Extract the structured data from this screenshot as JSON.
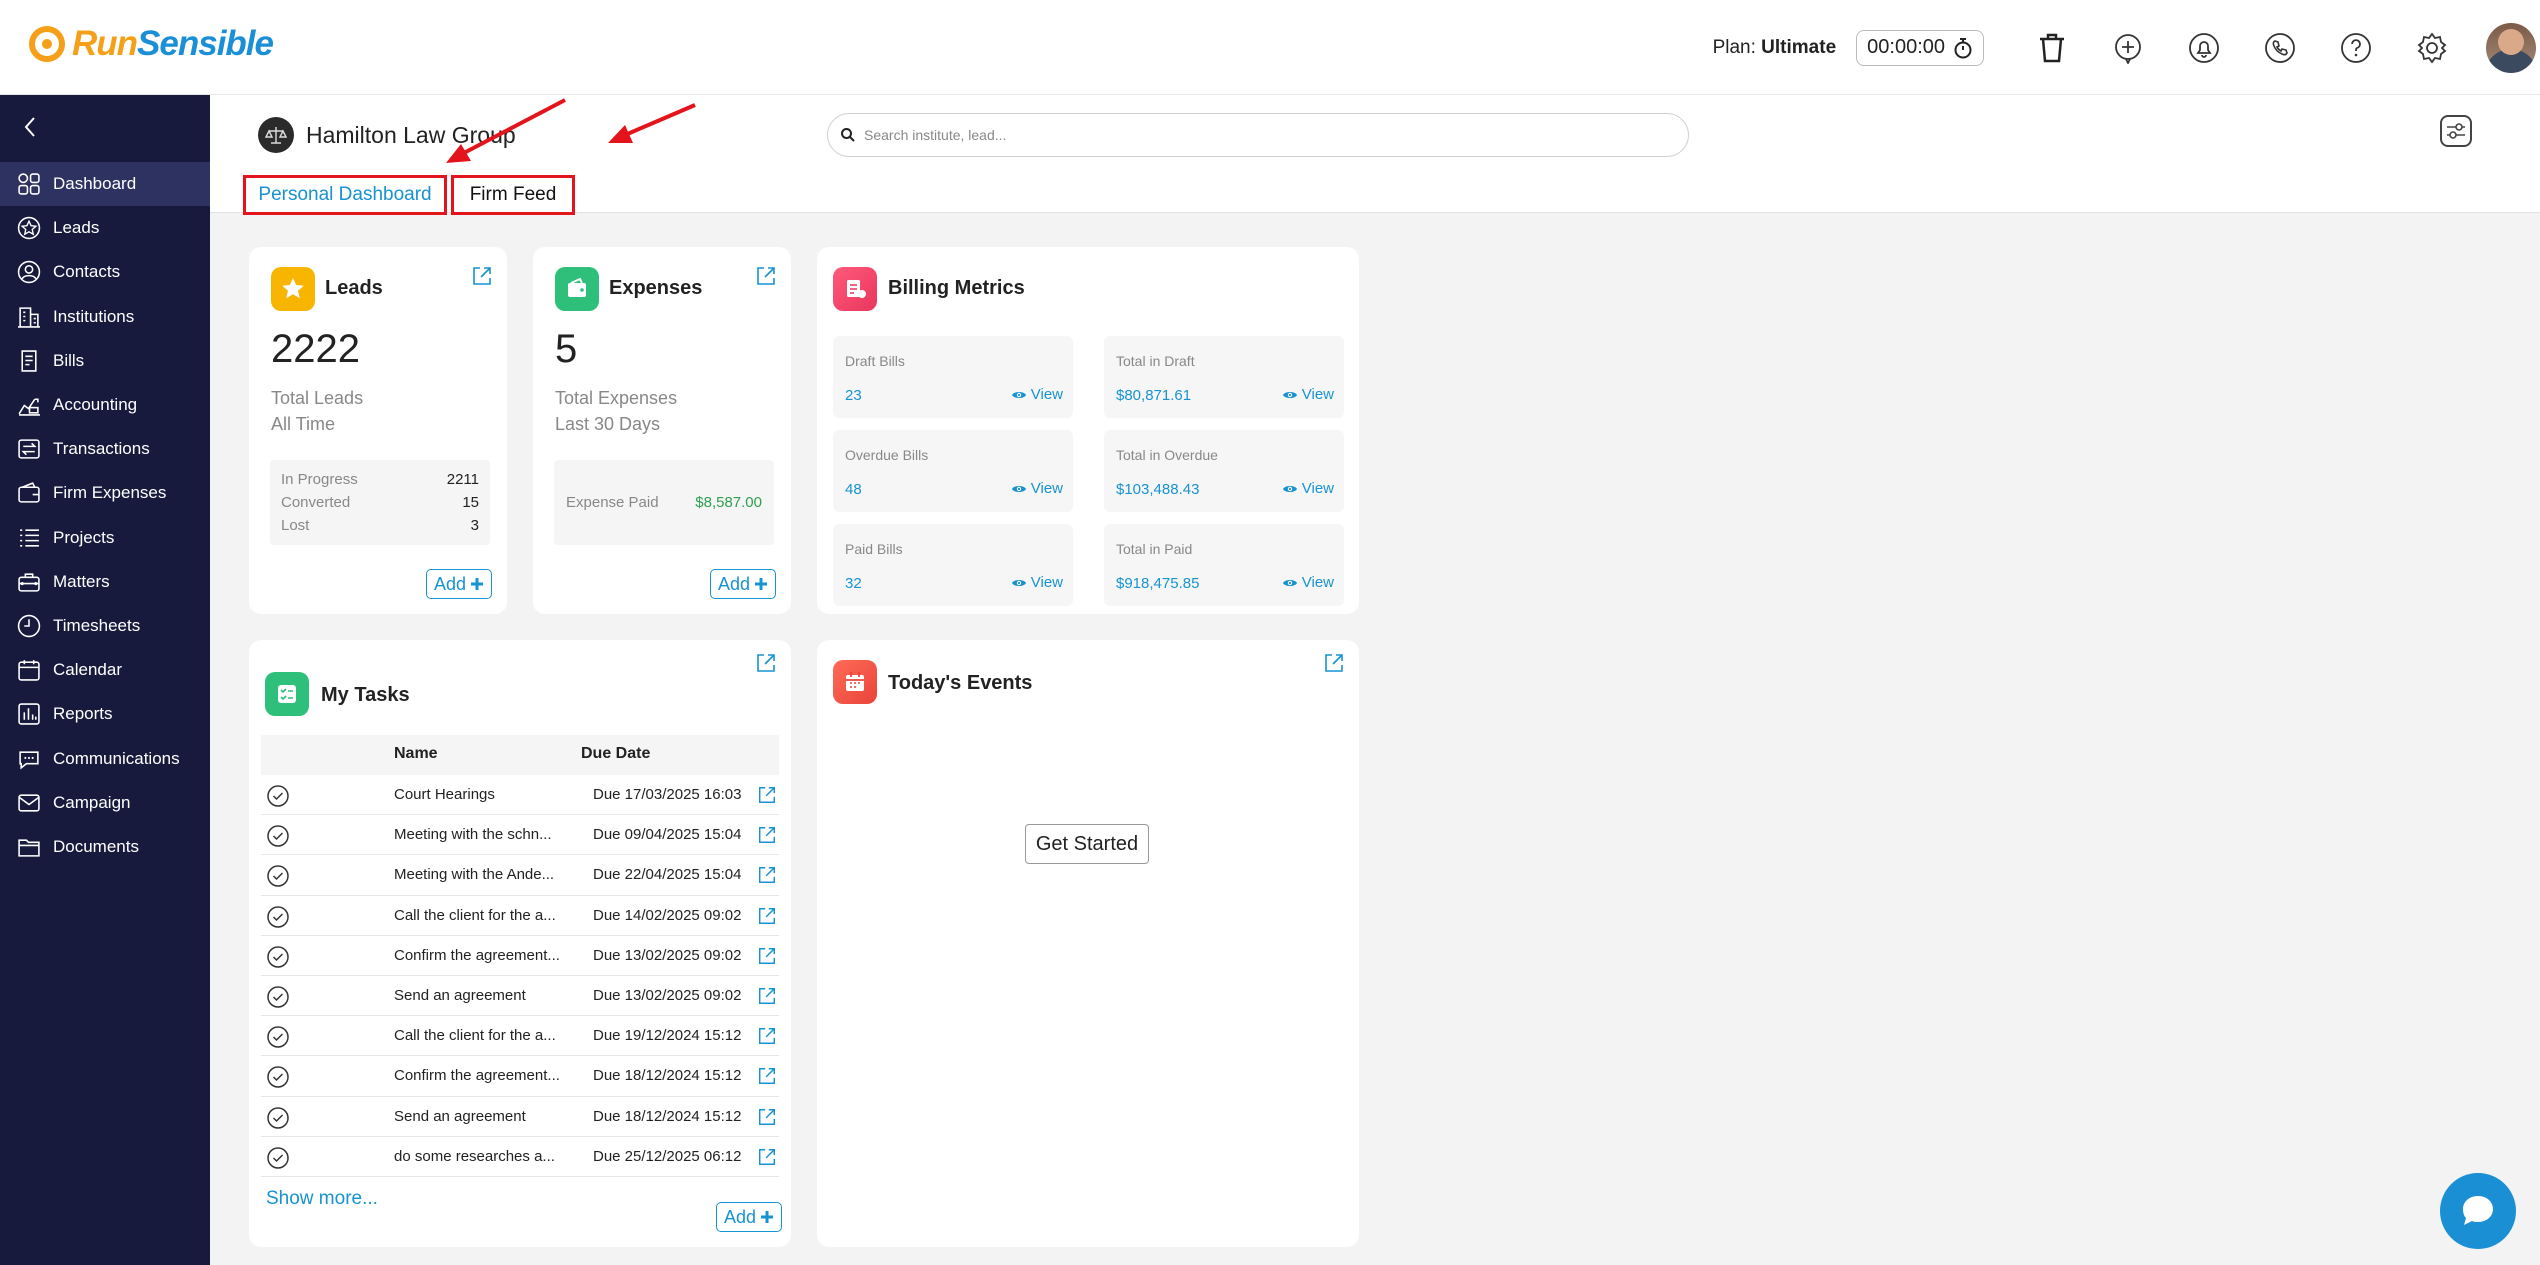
{
  "topbar": {
    "logo": {
      "part1": "Run",
      "part2": "Sensible"
    },
    "plan_label": "Plan:",
    "plan_value": "Ultimate",
    "timer": "00:00:00",
    "icons": [
      "trash-icon",
      "add-time-icon",
      "bell-icon",
      "phone-icon",
      "help-icon",
      "gear-icon"
    ]
  },
  "sidebar": {
    "items": [
      {
        "label": "Dashboard",
        "icon": "dashboard-icon",
        "active": true
      },
      {
        "label": "Leads",
        "icon": "star-icon"
      },
      {
        "label": "Contacts",
        "icon": "user-icon"
      },
      {
        "label": "Institutions",
        "icon": "building-icon"
      },
      {
        "label": "Bills",
        "icon": "bill-icon"
      },
      {
        "label": "Accounting",
        "icon": "accounting-icon"
      },
      {
        "label": "Transactions",
        "icon": "transactions-icon"
      },
      {
        "label": "Firm Expenses",
        "icon": "wallet-icon"
      },
      {
        "label": "Projects",
        "icon": "list-icon"
      },
      {
        "label": "Matters",
        "icon": "briefcase-icon"
      },
      {
        "label": "Timesheets",
        "icon": "clock-icon"
      },
      {
        "label": "Calendar",
        "icon": "calendar-icon"
      },
      {
        "label": "Reports",
        "icon": "chart-icon"
      },
      {
        "label": "Communications",
        "icon": "chat-icon"
      },
      {
        "label": "Campaign",
        "icon": "mail-icon"
      },
      {
        "label": "Documents",
        "icon": "folder-icon"
      }
    ]
  },
  "header": {
    "firm_name": "Hamilton Law Group",
    "tabs": {
      "personal": "Personal Dashboard",
      "firm": "Firm Feed"
    },
    "search_placeholder": "Search institute, lead..."
  },
  "colors": {
    "accent": "#1793d1",
    "sidebar": "#171a3d",
    "highlight": "#e3141c",
    "green": "#2e9e4f"
  },
  "leads": {
    "title": "Leads",
    "total": "2222",
    "sub1": "Total Leads",
    "sub2": "All Time",
    "stats": [
      {
        "label": "In Progress",
        "value": "2211"
      },
      {
        "label": "Converted",
        "value": "15"
      },
      {
        "label": "Lost",
        "value": "3"
      }
    ],
    "add": "Add"
  },
  "expenses": {
    "title": "Expenses",
    "total": "5",
    "sub1": "Total Expenses",
    "sub2": "Last 30 Days",
    "paid_label": "Expense Paid",
    "paid_value": "$8,587.00",
    "add": "Add"
  },
  "billing": {
    "title": "Billing Metrics",
    "view": "View",
    "cells": [
      {
        "label": "Draft Bills",
        "value": "23"
      },
      {
        "label": "Total in Draft",
        "value": "$80,871.61"
      },
      {
        "label": "Overdue Bills",
        "value": "48"
      },
      {
        "label": "Total in Overdue",
        "value": "$103,488.43"
      },
      {
        "label": "Paid Bills",
        "value": "32"
      },
      {
        "label": "Total in Paid",
        "value": "$918,475.85"
      }
    ]
  },
  "tasks": {
    "title": "My Tasks",
    "col_name": "Name",
    "col_due": "Due Date",
    "rows": [
      {
        "name": "Court Hearings",
        "due": "Due 17/03/2025 16:03"
      },
      {
        "name": "Meeting with the schn...",
        "due": "Due 09/04/2025 15:04"
      },
      {
        "name": "Meeting with the Ande...",
        "due": "Due 22/04/2025 15:04"
      },
      {
        "name": "Call the client for the a...",
        "due": "Due 14/02/2025 09:02"
      },
      {
        "name": "Confirm the agreement...",
        "due": "Due 13/02/2025 09:02"
      },
      {
        "name": "Send an agreement",
        "due": "Due 13/02/2025 09:02"
      },
      {
        "name": "Call the client for the a...",
        "due": "Due 19/12/2024 15:12"
      },
      {
        "name": "Confirm the agreement...",
        "due": "Due 18/12/2024 15:12"
      },
      {
        "name": "Send an agreement",
        "due": "Due 18/12/2024 15:12"
      },
      {
        "name": "do some researches a...",
        "due": "Due 25/12/2025 06:12"
      }
    ],
    "show_more": "Show more...",
    "add": "Add"
  },
  "events": {
    "title": "Today's Events",
    "get_started": "Get Started"
  }
}
